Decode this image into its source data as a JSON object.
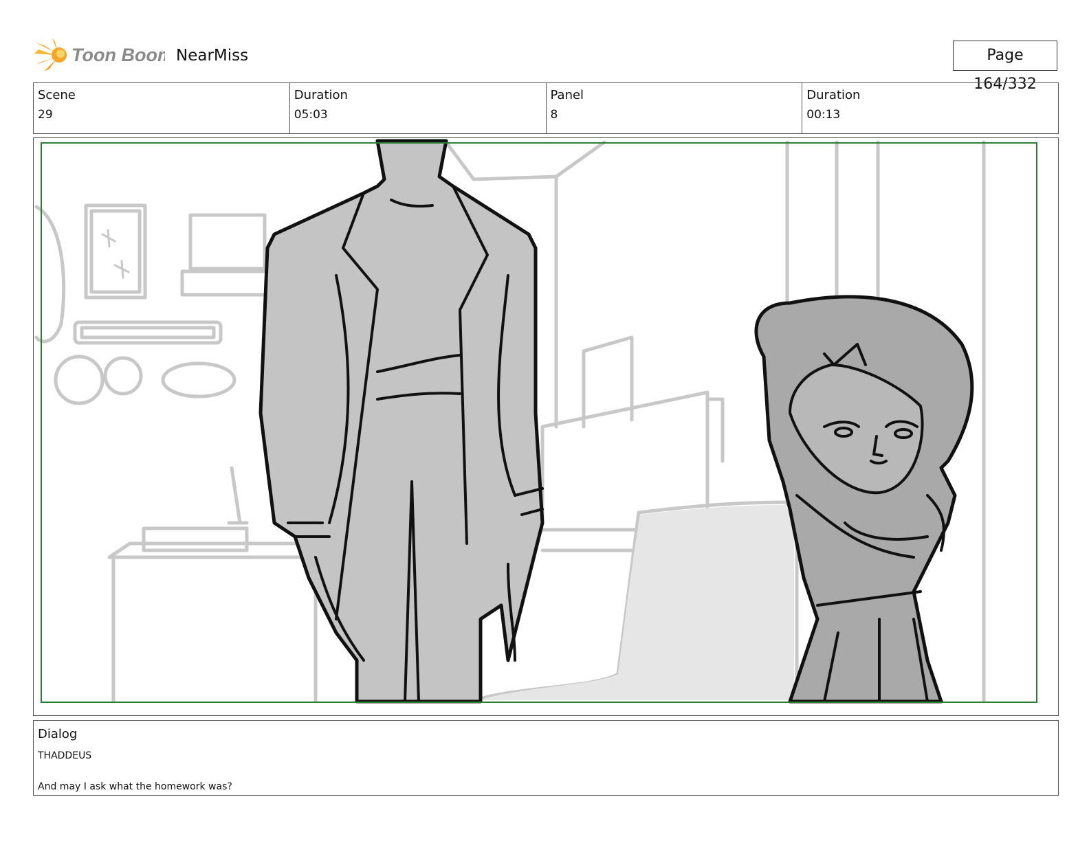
{
  "header": {
    "logo_text": "Toon Boom",
    "project_title": "NearMiss",
    "page_label": "Page 164/332"
  },
  "info": {
    "scene_label": "Scene",
    "scene_value": "29",
    "scene_duration_label": "Duration",
    "scene_duration_value": "05:03",
    "panel_label": "Panel",
    "panel_value": "8",
    "panel_duration_label": "Duration",
    "panel_duration_value": "00:13"
  },
  "dialog": {
    "label": "Dialog",
    "speaker": "THADDEUS",
    "line": "And may I ask what the homework was?"
  },
  "colors": {
    "logo_orange": "#f5a623",
    "logo_gray": "#8a8a8a",
    "safe_frame": "#2e7d32",
    "character_fill": "#c4c4c4",
    "background_lines": "#c8c8c8"
  }
}
